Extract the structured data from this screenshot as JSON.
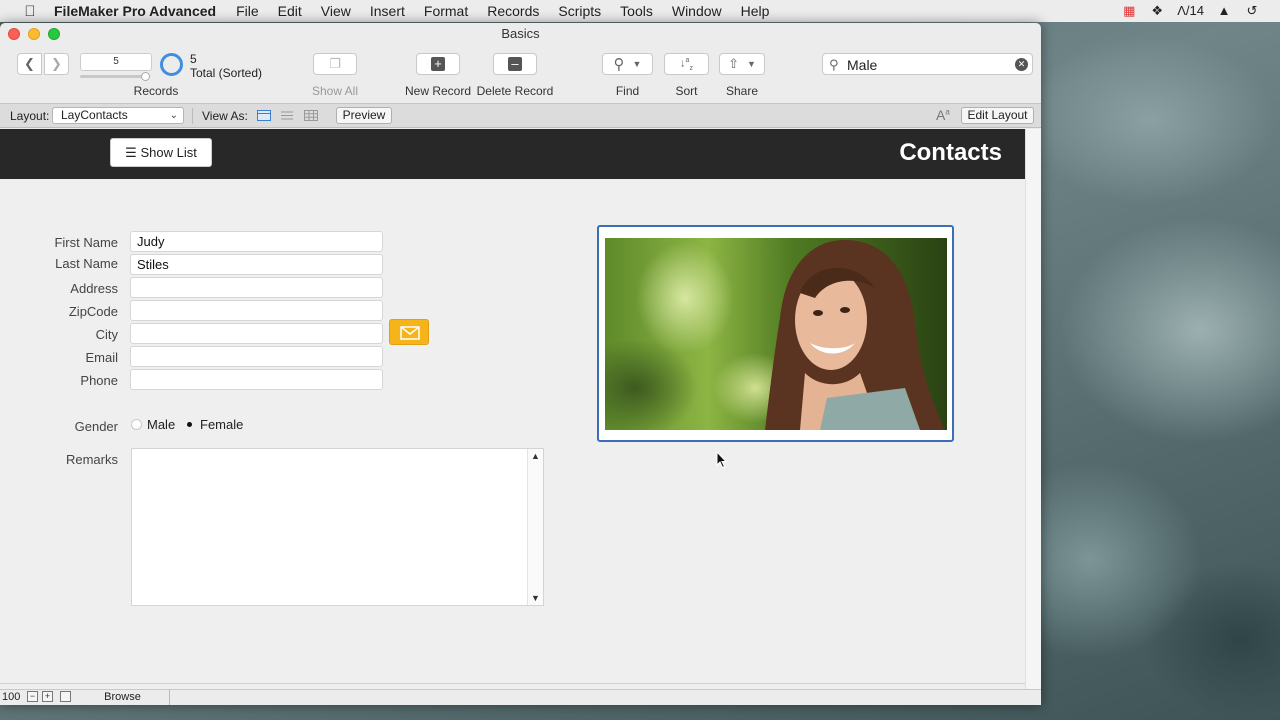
{
  "menubar": {
    "app_name": "FileMaker Pro Advanced",
    "items": [
      "File",
      "Edit",
      "View",
      "Insert",
      "Format",
      "Records",
      "Scripts",
      "Tools",
      "Window",
      "Help"
    ],
    "status_text": "14"
  },
  "window": {
    "title": "Basics"
  },
  "toolbar": {
    "record_number": "5",
    "found_count": "5",
    "total_label": "Total (Sorted)",
    "records_label": "Records",
    "show_all_label": "Show All",
    "new_record_label": "New Record",
    "delete_record_label": "Delete Record",
    "find_label": "Find",
    "sort_label": "Sort",
    "share_label": "Share",
    "search_value": "Male"
  },
  "layout_bar": {
    "layout_label": "Layout:",
    "layout_value": "LayContacts",
    "view_as_label": "View As:",
    "preview_label": "Preview",
    "edit_layout_label": "Edit Layout"
  },
  "header": {
    "show_list_label": "Show List",
    "title": "Contacts"
  },
  "form": {
    "fields": [
      {
        "label": "First Name",
        "value": "Judy"
      },
      {
        "label": "Last Name",
        "value": "Stiles"
      },
      {
        "label": "Address",
        "value": ""
      },
      {
        "label": "ZipCode",
        "value": ""
      },
      {
        "label": "City",
        "value": ""
      },
      {
        "label": "Email",
        "value": ""
      },
      {
        "label": "Phone",
        "value": ""
      }
    ],
    "gender_label": "Gender",
    "gender_options": [
      "Male",
      "Female"
    ],
    "gender_selected": "Female",
    "remarks_label": "Remarks",
    "remarks_value": ""
  },
  "statusbar": {
    "zoom": "100",
    "mode": "Browse"
  },
  "colors": {
    "accent": "#3d8fe0",
    "header_bg": "#282828",
    "mail_button": "#f5b51a",
    "photo_border": "#3b6fb5"
  }
}
